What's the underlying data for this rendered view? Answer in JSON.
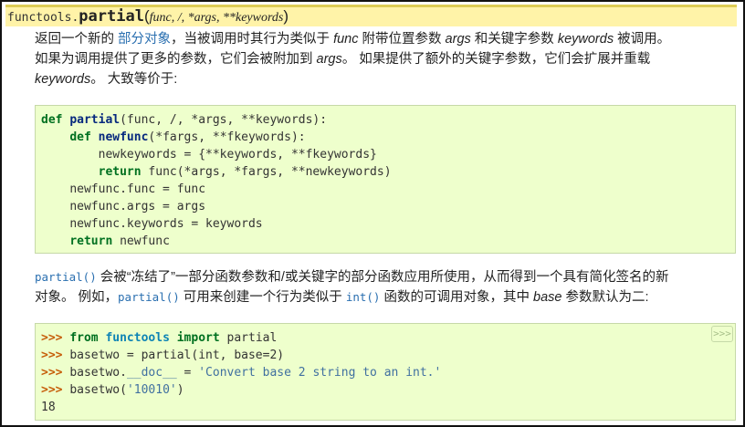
{
  "signature": {
    "module": "functools.",
    "name": "partial",
    "open_paren": "(",
    "args": "func, /, *args, **keywords",
    "close_paren": ")"
  },
  "description": {
    "p1_before_link": "返回一个新的 ",
    "p1_link": "部分对象",
    "p1_mid1": "，当被调用时其行为类似于 ",
    "p1_func": "func",
    "p1_mid2": " 附带位置参数 ",
    "p1_args": "args",
    "p1_mid3": " 和关键字参数 ",
    "p1_keywords": "keywords",
    "p1_line1_end": " 被调用。",
    "p1_line2_start": "如果为调用提供了更多的参数，它们会被附加到 ",
    "p1_args2": "args",
    "p1_line2_end": "。 如果提供了额外的关键字参数，它们会扩展并重载",
    "p1_keywords2": "keywords",
    "p1_line3_end": "。 大致等价于:"
  },
  "code_block_1": {
    "lines": [
      {
        "kw": "def ",
        "fn": "partial",
        "rest": "(func, /, *args, **keywords):"
      },
      {
        "indent": "    ",
        "kw": "def ",
        "fn": "newfunc",
        "rest": "(*fargs, **fkeywords):"
      },
      {
        "indent": "        ",
        "rest": "newkeywords = {**keywords, **fkeywords}"
      },
      {
        "indent": "        ",
        "kw": "return ",
        "rest": "func(*args, *fargs, **newkeywords)"
      },
      {
        "indent": "    ",
        "rest": "newfunc.func = func"
      },
      {
        "indent": "    ",
        "rest": "newfunc.args = args"
      },
      {
        "indent": "    ",
        "rest": "newfunc.keywords = keywords"
      },
      {
        "indent": "    ",
        "kw": "return ",
        "rest": "newfunc"
      }
    ]
  },
  "description2": {
    "code_partial": "partial()",
    "l1": " 会被“冻结了”一部分函数参数和/或关键字的部分函数应用所使用，从而得到一个具有简化签名的新",
    "l2_start": "对象。 例如，",
    "code_partial2": "partial()",
    "l2_mid": " 可用来创建一个行为类似于 ",
    "code_int": "int()",
    "l2_mid2": " 函数的可调用对象，其中 ",
    "base": "base",
    "l2_end": " 参数默认为二:"
  },
  "code_block_2": {
    "prompt": ">>> ",
    "line1_kw1": "from ",
    "line1_mod": "functools ",
    "line1_kw2": "import ",
    "line1_rest": "partial",
    "line2": "basetwo = partial(int, base=2)",
    "line3_pre": "basetwo.",
    "line3_dunder": "__doc__",
    "line3_mid": " = ",
    "line3_str": "'Convert base 2 string to an int.'",
    "line4_pre": "basetwo(",
    "line4_str": "'10010'",
    "line4_post": ")",
    "output": "18",
    "copy_button": ">>>"
  }
}
